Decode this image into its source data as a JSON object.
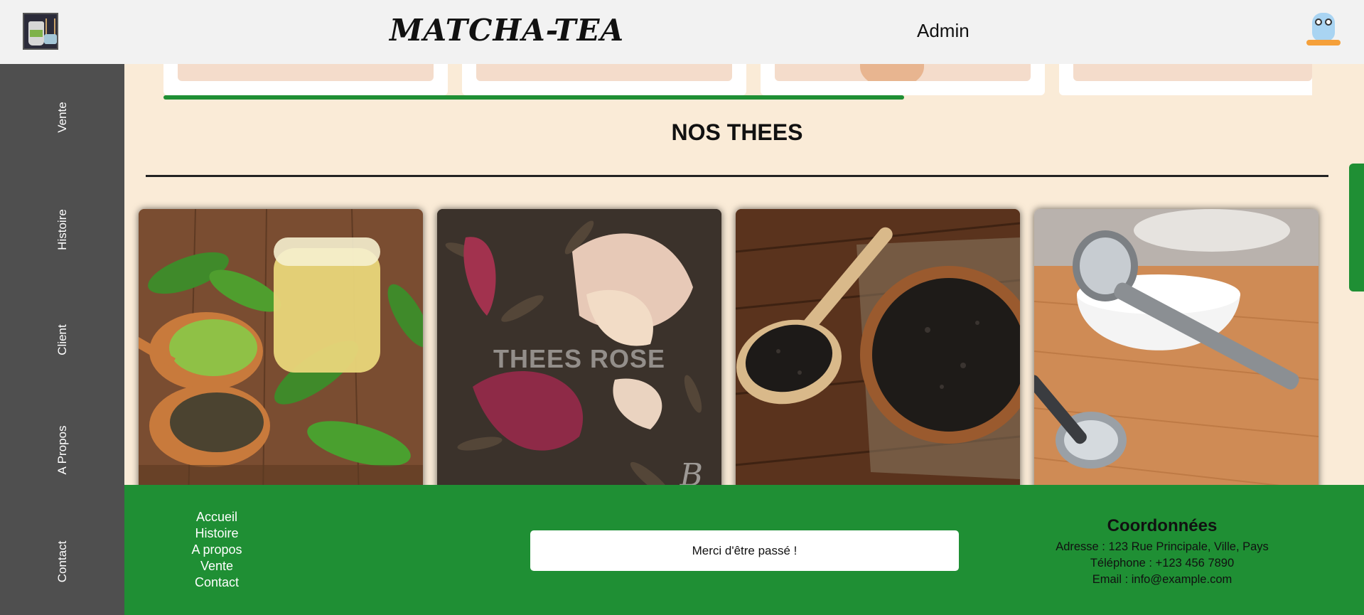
{
  "header": {
    "brand": "MATCHA-TEA",
    "user": "Admin",
    "logo_icon": "tea-set-logo-icon",
    "avatar_icon": "owl-avatar-icon"
  },
  "sidebar": {
    "items": [
      {
        "label": "Vente"
      },
      {
        "label": "Histoire"
      },
      {
        "label": "Client"
      },
      {
        "label": "A Propos"
      },
      {
        "label": "Contact"
      }
    ]
  },
  "main": {
    "section_title": "NOS THEES",
    "cards": [
      {
        "image": "green-tea-with-matcha-and-leaves",
        "overlay": ""
      },
      {
        "image": "dried-tea-with-rose-petals",
        "overlay": "THEES ROSE",
        "watermark": "B"
      },
      {
        "image": "black-tea-in-wooden-bowl",
        "overlay": ""
      },
      {
        "image": "tea-measuring-spoon-and-cup",
        "overlay": ""
      }
    ],
    "carousel_progress": 0.58
  },
  "footer": {
    "links": [
      "Accueil",
      "Histoire",
      "A propos",
      "Vente",
      "Contact"
    ],
    "thanks": "Merci d'être passé !",
    "coords_title": "Coordonnées",
    "address": "Adresse : 123 Rue Principale, Ville, Pays",
    "phone": "Téléphone : +123 456 7890",
    "email": "Email : info@example.com"
  },
  "colors": {
    "header_bg": "#f2f2f2",
    "sidebar_bg": "#4f4f4f",
    "page_bg": "#faebd7",
    "accent_green": "#1f8f34"
  }
}
